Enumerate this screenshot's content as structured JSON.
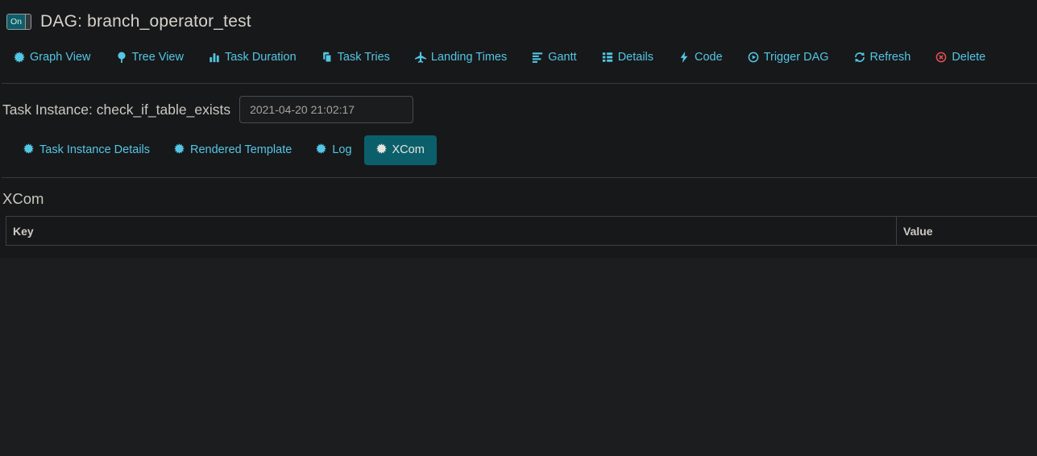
{
  "colors": {
    "accent": "#53c6e4",
    "active_tab_bg": "#0b5f6b",
    "toggle_bg": "#0b5f6b",
    "delete_icon_red": "#e05252",
    "page_bg": "#17181a",
    "footer_bg": "#1c1d1f",
    "border": "#3e4043",
    "title_text": "#d6d2cb"
  },
  "header": {
    "toggle_label": "On",
    "title": "DAG: branch_operator_test"
  },
  "nav": {
    "items": [
      {
        "label": "Graph View",
        "icon": "certificate-icon"
      },
      {
        "label": "Tree View",
        "icon": "tree-icon"
      },
      {
        "label": "Task Duration",
        "icon": "bar-chart-icon"
      },
      {
        "label": "Task Tries",
        "icon": "duplicate-icon"
      },
      {
        "label": "Landing Times",
        "icon": "plane-icon"
      },
      {
        "label": "Gantt",
        "icon": "align-left-icon"
      },
      {
        "label": "Details",
        "icon": "list-icon"
      },
      {
        "label": "Code",
        "icon": "bolt-icon"
      },
      {
        "label": "Trigger DAG",
        "icon": "play-circle-icon"
      },
      {
        "label": "Refresh",
        "icon": "refresh-icon"
      },
      {
        "label": "Delete",
        "icon": "remove-circle-icon"
      }
    ]
  },
  "task_instance": {
    "label": "Task Instance: check_if_table_exists",
    "execution_date": "2021-04-20 21:02:17"
  },
  "subtabs": {
    "items": [
      {
        "label": "Task Instance Details",
        "icon": "certificate-icon",
        "active": false
      },
      {
        "label": "Rendered Template",
        "icon": "certificate-icon",
        "active": false
      },
      {
        "label": "Log",
        "icon": "certificate-icon",
        "active": false
      },
      {
        "label": "XCom",
        "icon": "certificate-icon",
        "active": true
      }
    ]
  },
  "xcom": {
    "heading": "XCom",
    "table": {
      "columns": [
        "Key",
        "Value"
      ],
      "rows": []
    }
  }
}
